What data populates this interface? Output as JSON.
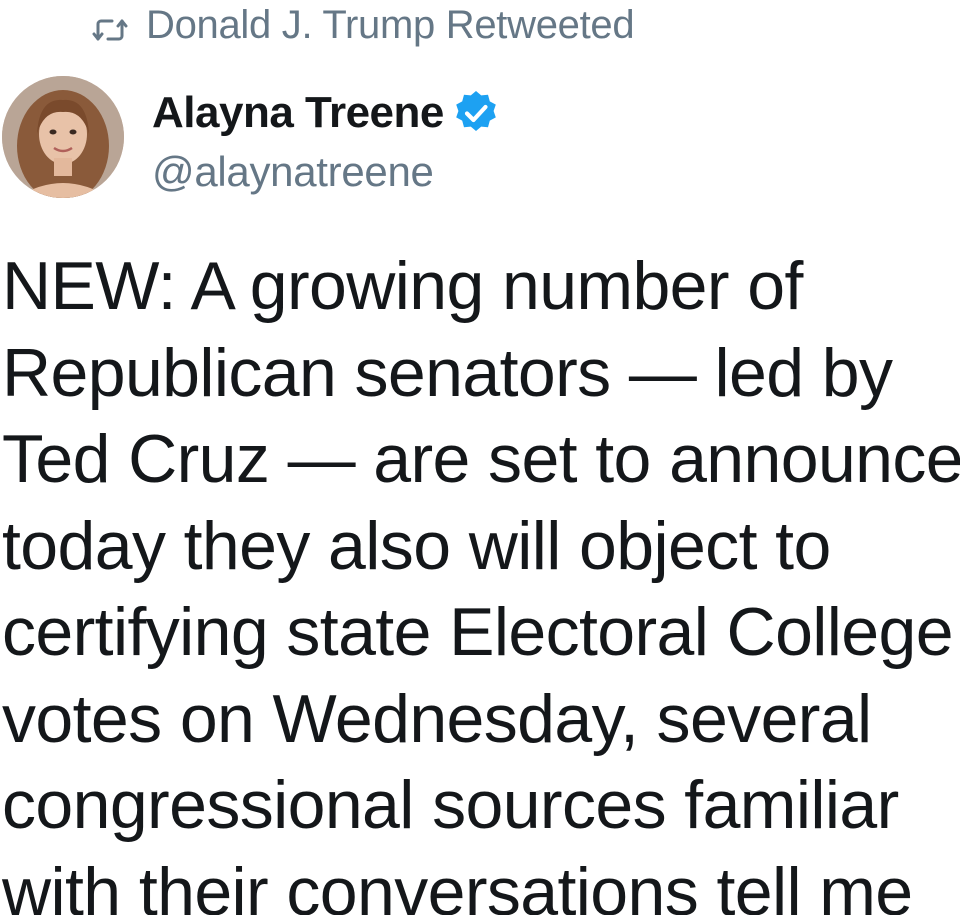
{
  "retweet_context": {
    "icon": "retweet-icon",
    "text": "Donald J. Trump Retweeted"
  },
  "author": {
    "name": "Alayna Treene",
    "handle": "@alaynatreene",
    "verified_icon": "verified-badge-icon",
    "verified_color": "#1da1f2"
  },
  "tweet": {
    "lines": [
      "NEW: A growing number of",
      "Republican senators — led by",
      "Ted Cruz — are set to announce",
      "today they also will object to",
      "certifying state Electoral College",
      "votes on Wednesday, several",
      "congressional sources familiar",
      "with their conversations tell me"
    ]
  },
  "colors": {
    "text_primary": "#14171a",
    "text_secondary": "#657786"
  }
}
